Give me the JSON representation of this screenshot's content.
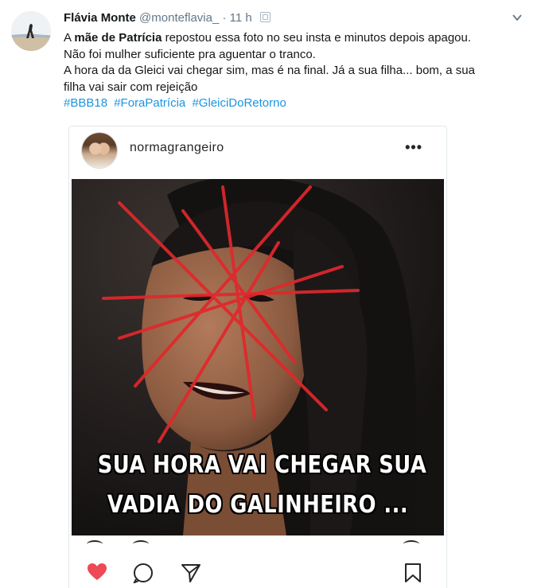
{
  "tweet": {
    "author_name": "Flávia Monte",
    "author_handle": "@monteflavia_",
    "separator": "·",
    "timestamp": "11 h",
    "text": {
      "line1_before": "A ",
      "line1_bold": "mãe de Patrícia",
      "line1_after": " repostou essa foto no seu insta e minutos depois apagou.",
      "line2": "Não foi mulher suficiente pra aguentar o tranco.",
      "line3": "A hora da da Gleici vai chegar sim, mas é na final. Já a sua filha... bom, a sua",
      "line4": "filha vai sair com rejeição"
    },
    "hashtags": [
      "#BBB18",
      "#ForaPatrícia",
      "#GleiciDoRetorno"
    ]
  },
  "embed": {
    "username": "normagrangeiro",
    "more_icon": "ellipsis-icon",
    "caption_line1": "SUA HORA VAI CHEGAR SUA",
    "caption_line2": "VADIA DO GALINHEIRO ..."
  },
  "icons": {
    "like": "heart-icon",
    "comment": "comment-icon",
    "share": "share-icon",
    "save": "bookmark-icon",
    "tweet_menu": "chevron-down-icon"
  },
  "colors": {
    "link": "#1b95e0",
    "like_red": "#ed4956",
    "scribble_red": "#e0282c"
  }
}
